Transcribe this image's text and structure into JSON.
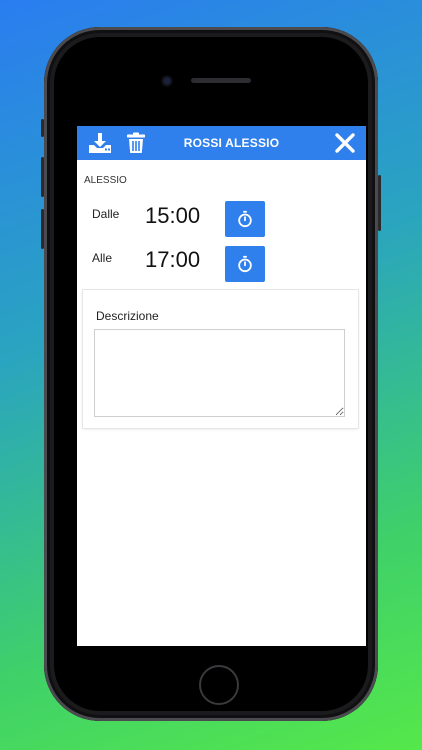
{
  "header": {
    "title": "ROSSI ALESSIO",
    "download_icon": "download-tray-icon",
    "delete_icon": "trash-icon",
    "close_icon": "close-icon"
  },
  "user_label": "ALESSIO",
  "time_rows": [
    {
      "label": "Dalle",
      "value": "15:00",
      "button_icon": "stopwatch-icon"
    },
    {
      "label": "Alle",
      "value": "17:00",
      "button_icon": "stopwatch-icon"
    }
  ],
  "description": {
    "label": "Descrizione",
    "value": "",
    "placeholder": ""
  },
  "colors": {
    "accent": "#2f80ed",
    "background_top": "#2a7df0",
    "background_bottom": "#55e84a"
  }
}
